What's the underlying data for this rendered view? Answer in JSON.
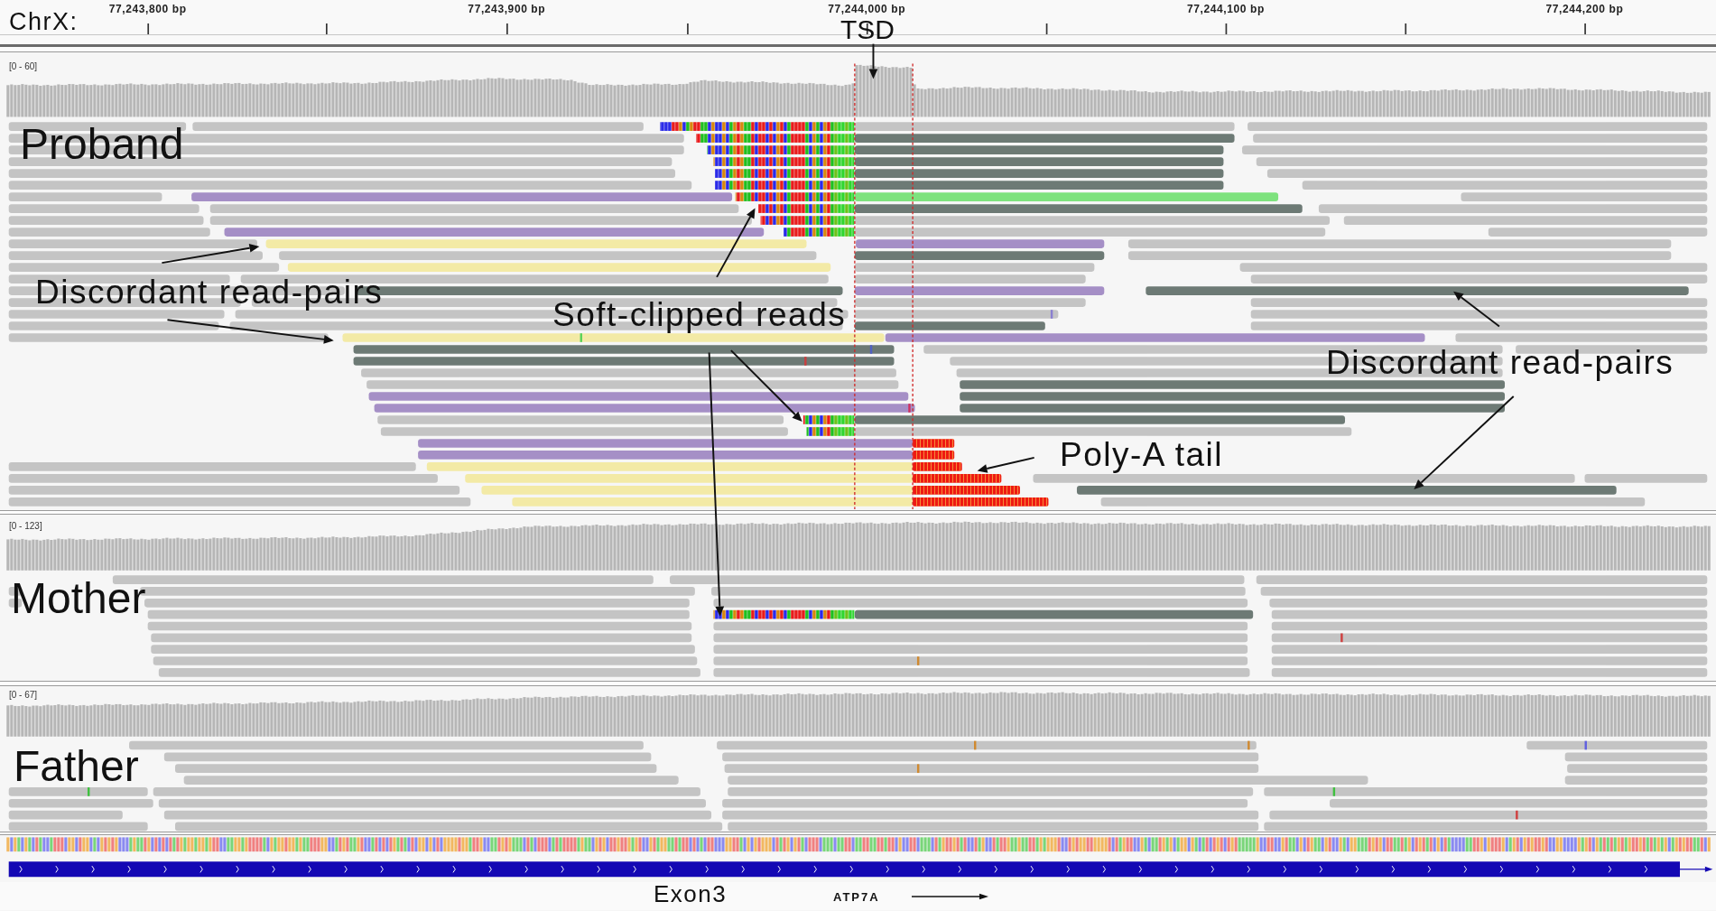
{
  "ruler": {
    "chromosome": "ChrX:",
    "tick_labels": [
      "77,243,800 bp",
      "77,243,900 bp",
      "77,244,000 bp",
      "77,244,100 bp",
      "77,244,200 bp"
    ]
  },
  "tracks": [
    {
      "sample": "Proband",
      "data_range": "[0 - 60]"
    },
    {
      "sample": "Mother",
      "data_range": "[0 - 123]"
    },
    {
      "sample": "Father",
      "data_range": "[0 - 67]"
    }
  ],
  "annotations": [
    {
      "text": "TSD"
    },
    {
      "text": "Discordant read-pairs"
    },
    {
      "text": "Soft-clipped reads"
    },
    {
      "text": "Discordant read-pairs"
    },
    {
      "text": "Poly-A tail"
    }
  ],
  "gene_track": {
    "exon_label": "Exon3",
    "gene_name": "ATP7A"
  }
}
